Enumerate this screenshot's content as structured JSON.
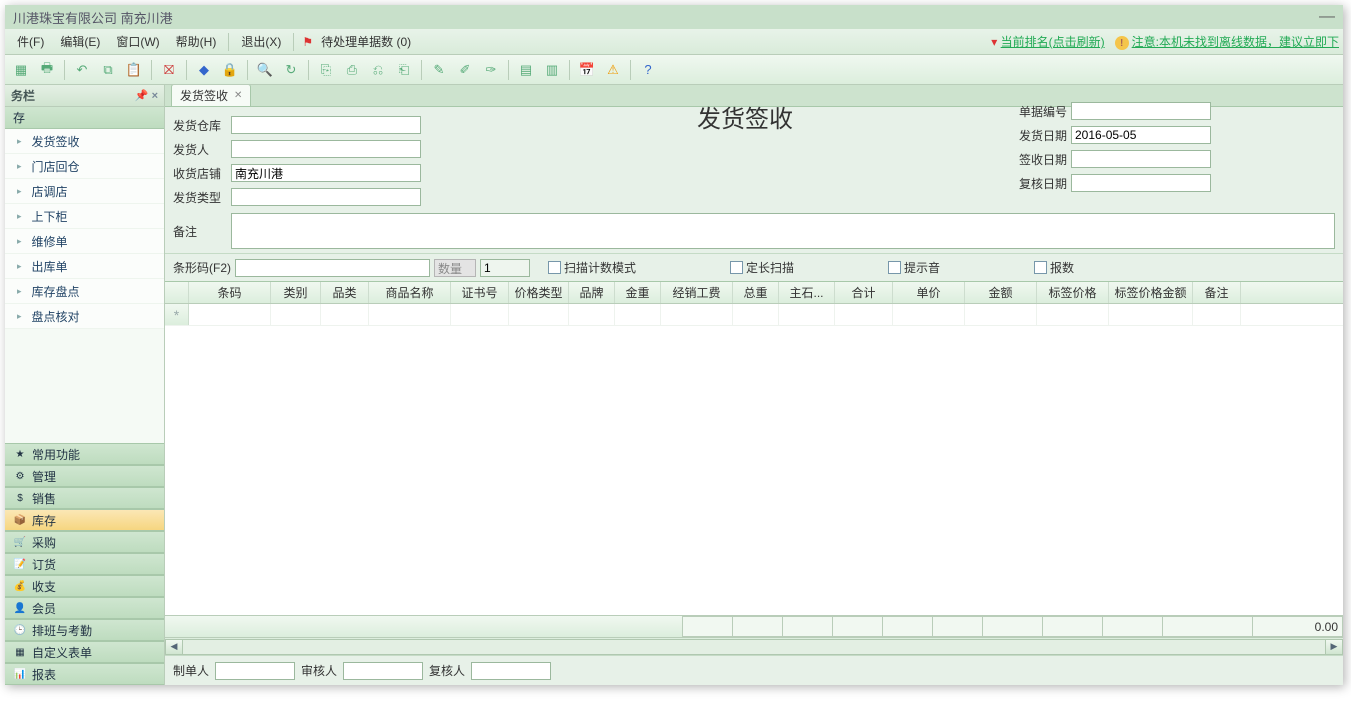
{
  "title": "川港珠宝有限公司 南充川港",
  "menu": {
    "file": "件(F)",
    "edit": "编辑(E)",
    "window": "窗口(W)",
    "help": "帮助(H)",
    "exit": "退出(X)",
    "pending": "待处理单据数",
    "pending_count": "(0)"
  },
  "status": {
    "rank": "当前排名(点击刷新)",
    "warn": "注意:本机未找到离线数据，建议立即下"
  },
  "panel": {
    "title": "务栏"
  },
  "groups": {
    "g_top": "存",
    "items": [
      "发货签收",
      "门店回仓",
      "店调店",
      "上下柜",
      "维修单",
      "出库单",
      "库存盘点",
      "盘点核对"
    ],
    "changyong": "常用功能",
    "guanli": "管理",
    "xiaoshou": "销售",
    "kucun": "库存",
    "caigou": "采购",
    "dinghuo": "订货",
    "shouzi": "收支",
    "huiyuan": "会员",
    "paiban": "排班与考勤",
    "zidingyi": "自定义表单",
    "baobiao": "报表"
  },
  "tab": {
    "label": "发货签收"
  },
  "page_title": "发货签收",
  "form": {
    "warehouse_lbl": "发货仓库",
    "warehouse": "",
    "sender_lbl": "发货人",
    "sender": "",
    "receiver_lbl": "收货店铺",
    "receiver": "南充川港",
    "type_lbl": "发货类型",
    "type": "",
    "remark_lbl": "备注",
    "remark": "",
    "docno_lbl": "单据编号",
    "docno": "",
    "senddate_lbl": "发货日期",
    "senddate": "2016-05-05",
    "signdate_lbl": "签收日期",
    "signdate": "",
    "checkdate_lbl": "复核日期",
    "checkdate": ""
  },
  "scan": {
    "barcode_lbl": "条形码(F2)",
    "qty_lbl": "数量",
    "qty": "1",
    "mode": "扫描计数模式",
    "fixed": "定长扫描",
    "beep": "提示音",
    "report": "报数"
  },
  "cols": {
    "barcode": "条码",
    "cat": "类别",
    "kind": "品类",
    "name": "商品名称",
    "cert": "证书号",
    "pricetype": "价格类型",
    "brand": "品牌",
    "gold": "金重",
    "fee": "经销工费",
    "total_w": "总重",
    "main_stone": "主石...",
    "sum": "合计",
    "unit": "单价",
    "amount": "金额",
    "tag_price": "标签价格",
    "tag_amount": "标签价格金额",
    "remark": "备注"
  },
  "summary": {
    "total": "0.00"
  },
  "footer": {
    "maker_lbl": "制单人",
    "maker": "",
    "auditor_lbl": "审核人",
    "auditor": "",
    "checker_lbl": "复核人",
    "checker": ""
  },
  "colwidths": {
    "barcode": 82,
    "cat": 50,
    "kind": 48,
    "name": 82,
    "cert": 58,
    "pricetype": 60,
    "brand": 46,
    "gold": 46,
    "fee": 72,
    "total_w": 46,
    "main_stone": 56,
    "sum": 58,
    "unit": 72,
    "amount": 72,
    "tag_price": 72,
    "tag_amount": 84,
    "remark": 48
  }
}
